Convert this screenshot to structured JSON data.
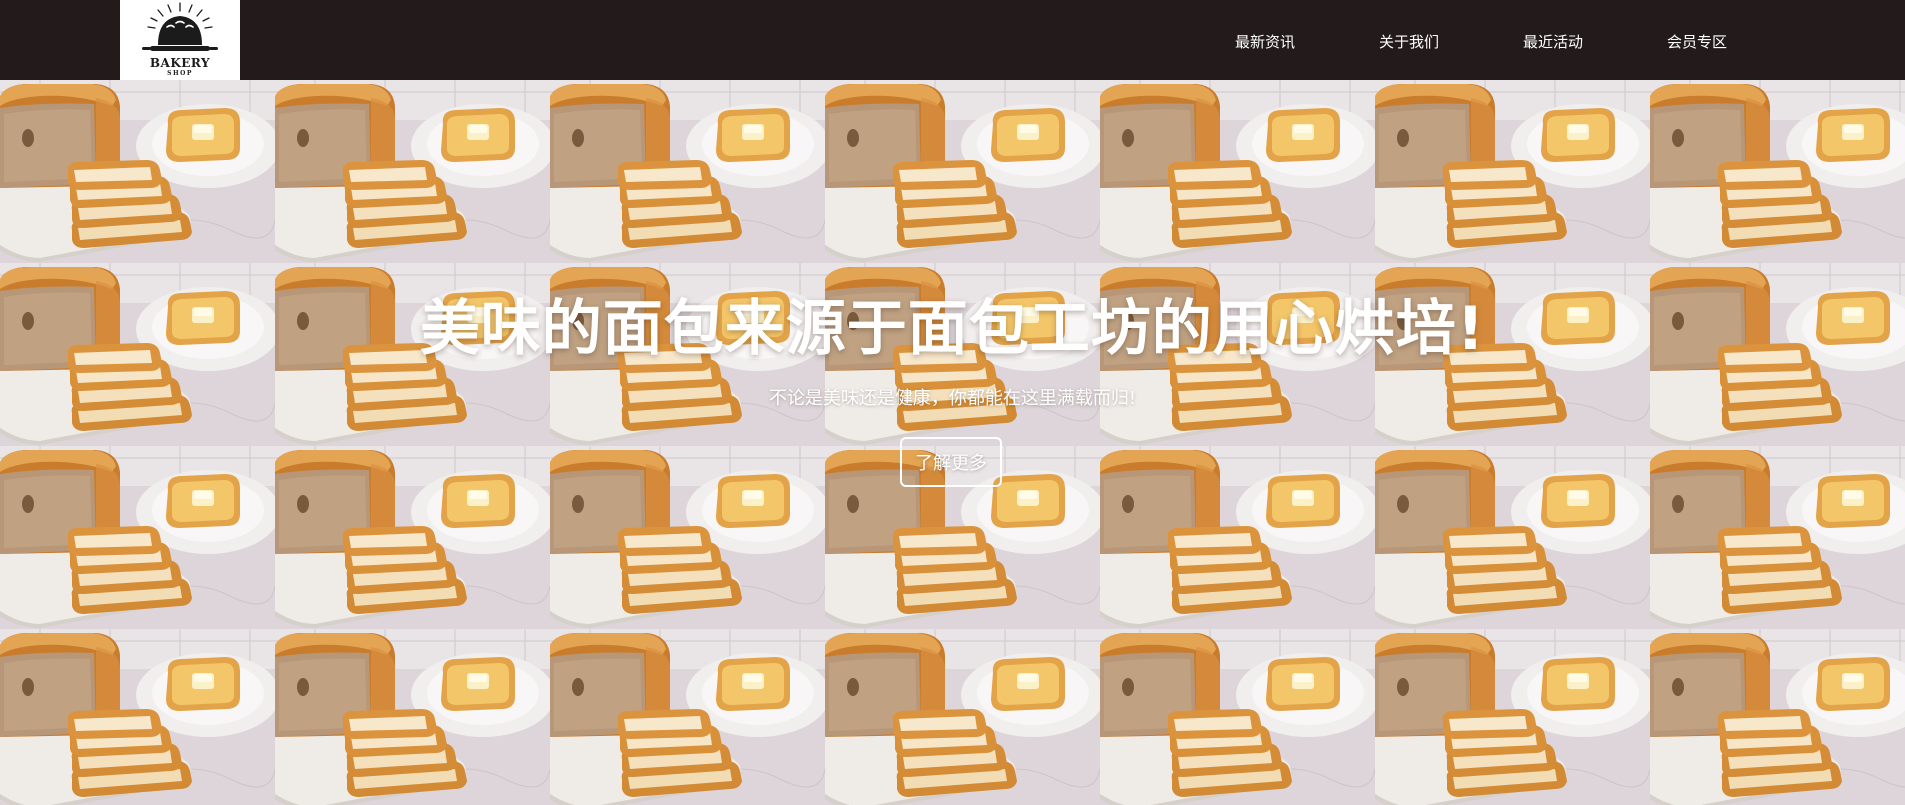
{
  "header": {
    "logo": {
      "text": "BAKERY",
      "subtext": "SHOP",
      "icon": "bread-loaf-rolling-pin-icon"
    },
    "nav": [
      {
        "label": "最新资讯"
      },
      {
        "label": "关于我们"
      },
      {
        "label": "最近活动"
      },
      {
        "label": "会员专区"
      }
    ]
  },
  "hero": {
    "title": "美味的面包来源于面包工坊的用心烘培!",
    "subtitle": "不论是美味还是健康，你都能在这里满载而归!",
    "button_label": "了解更多",
    "background_image": "sliced-bread-loaf-with-butter-toast-tile"
  },
  "colors": {
    "header_bg": "#231b1b",
    "logo_bg": "#ffffff",
    "text_on_dark": "#ffffff",
    "hero_bg": "#d8d0d3"
  }
}
